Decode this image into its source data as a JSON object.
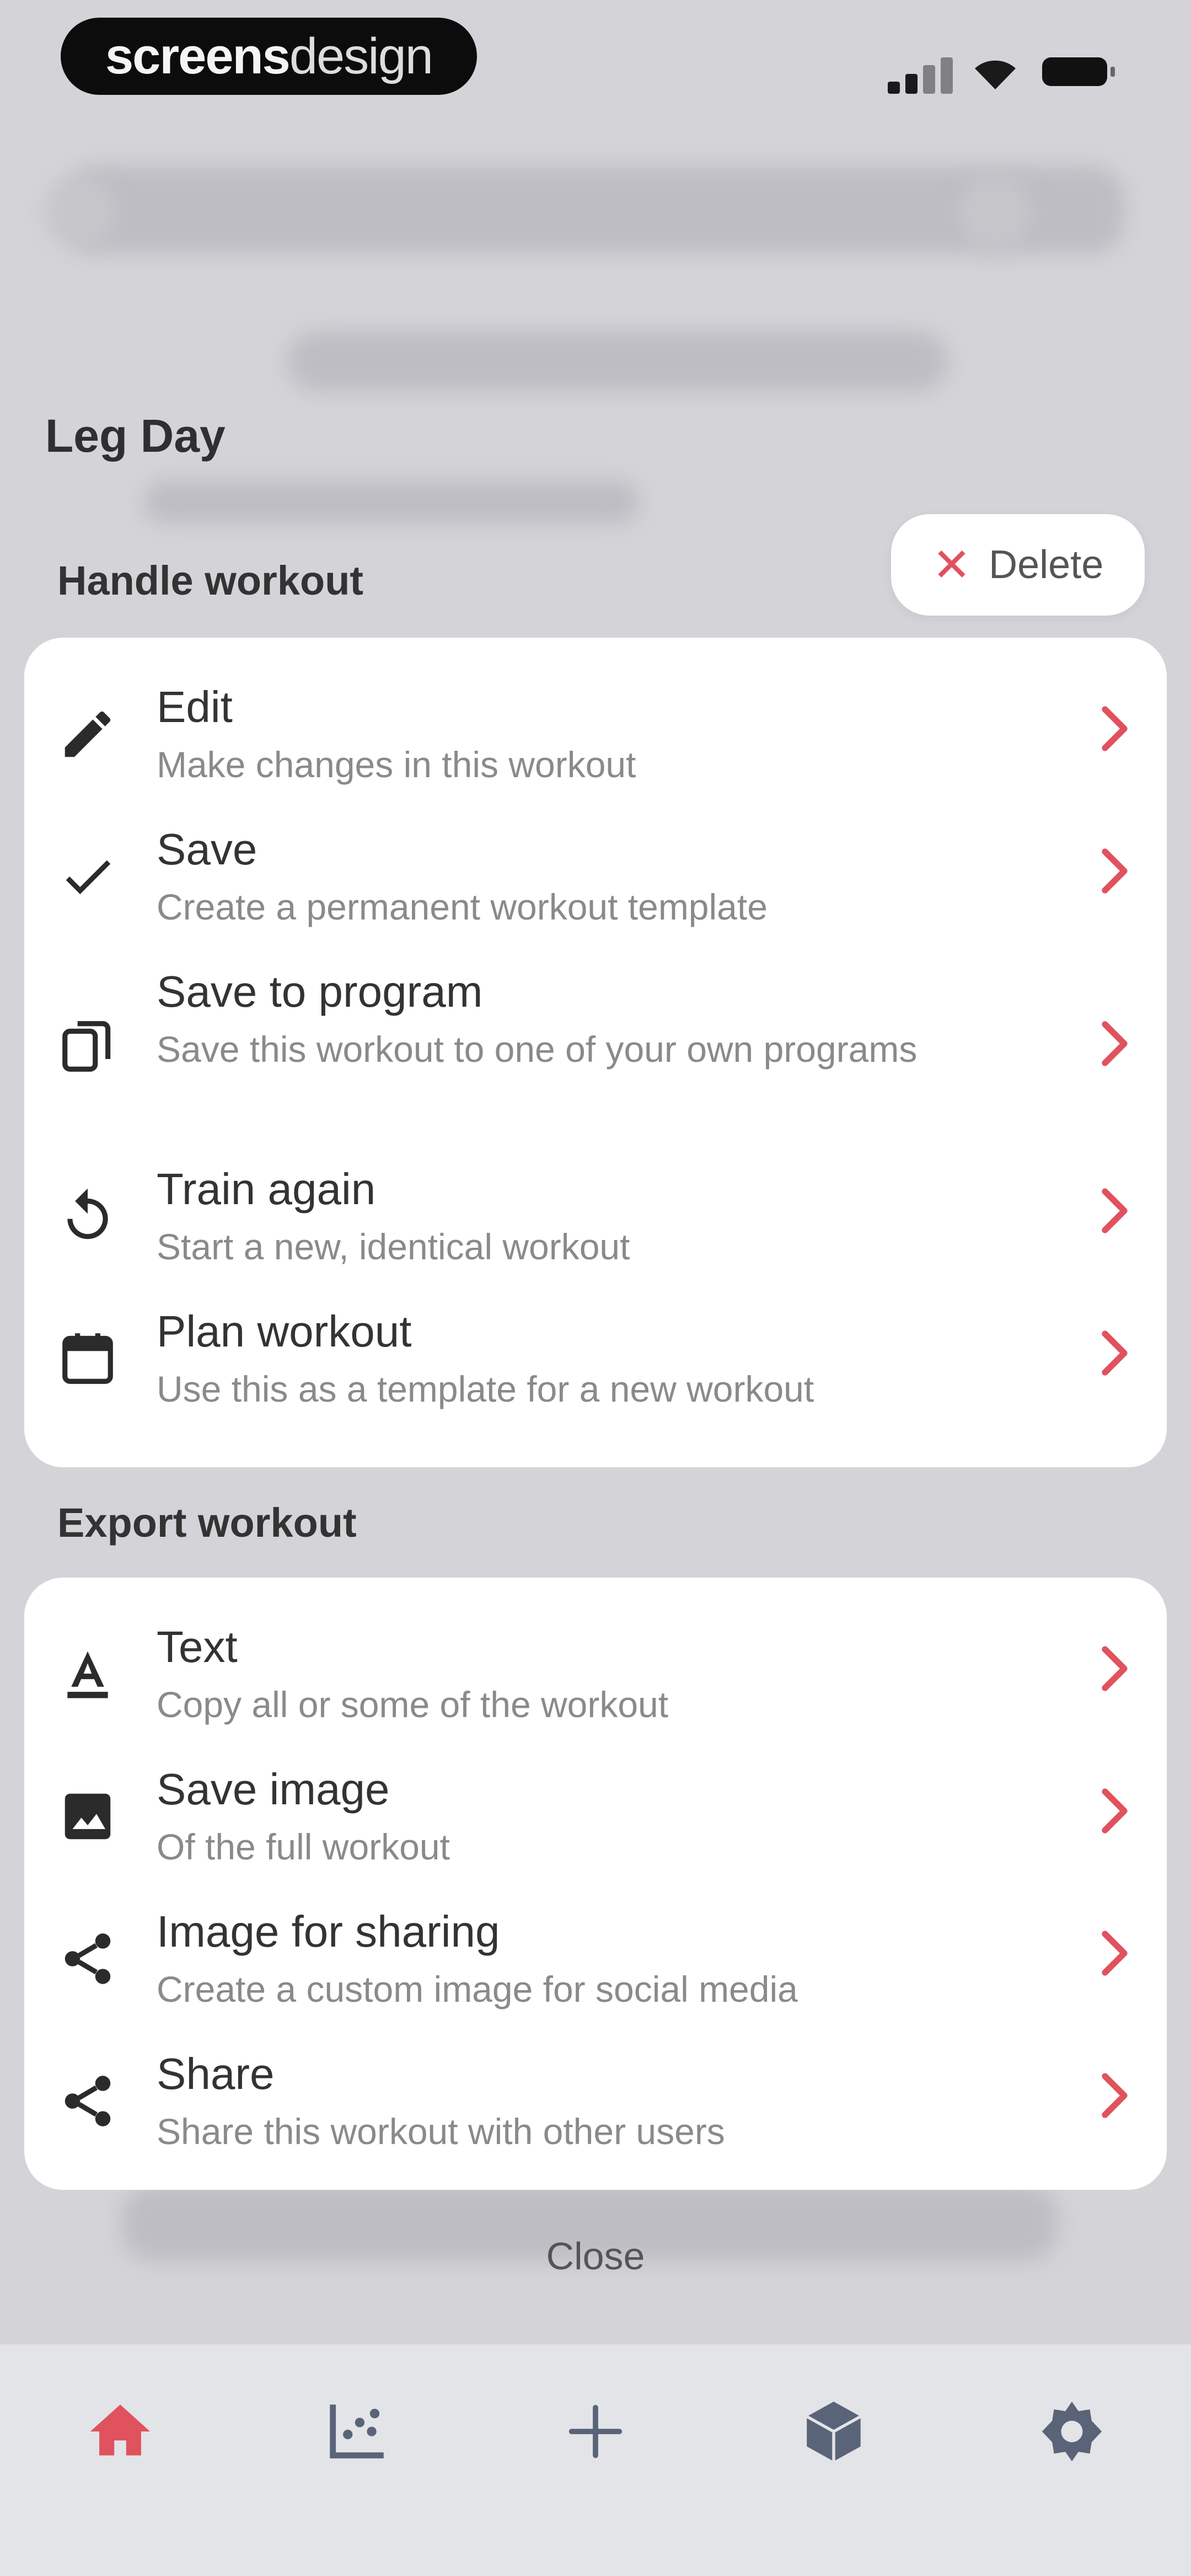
{
  "brand": {
    "bold": "screens",
    "light": "design"
  },
  "workout": {
    "title": "Leg Day"
  },
  "delete_label": "Delete",
  "handle_section": {
    "title": "Handle workout",
    "items": [
      {
        "icon": "pencil-icon",
        "title": "Edit",
        "subtitle": "Make changes in this workout"
      },
      {
        "icon": "checkmark-icon",
        "title": "Save",
        "subtitle": "Create a permanent workout template"
      },
      {
        "icon": "copy-icon",
        "title": "Save to program",
        "subtitle": "Save this workout to one of your own programs"
      },
      {
        "icon": "restart-icon",
        "title": "Train again",
        "subtitle": "Start a new, identical workout"
      },
      {
        "icon": "calendar-icon",
        "title": "Plan workout",
        "subtitle": "Use this as a template for a new workout"
      }
    ]
  },
  "export_section": {
    "title": "Export workout",
    "items": [
      {
        "icon": "text-icon",
        "title": "Text",
        "subtitle": "Copy all or some of the workout"
      },
      {
        "icon": "image-icon",
        "title": "Save image",
        "subtitle": "Of the full workout"
      },
      {
        "icon": "share-icon",
        "title": "Image for sharing",
        "subtitle": "Create a custom image for social media"
      },
      {
        "icon": "share-icon",
        "title": "Share",
        "subtitle": "Share this workout with other users"
      }
    ]
  },
  "close_label": "Close",
  "tabs": [
    {
      "icon": "home-icon",
      "active": true
    },
    {
      "icon": "chart-icon",
      "active": false
    },
    {
      "icon": "plus-icon",
      "active": false
    },
    {
      "icon": "cube-icon",
      "active": false
    },
    {
      "icon": "gear-icon",
      "active": false
    }
  ],
  "colors": {
    "accent": "#e0525d",
    "icon_dark": "#2b2b2b",
    "tab_inactive": "#5a6478",
    "card_bg": "#ffffff",
    "overlay_bg": "#d4d4d8"
  }
}
